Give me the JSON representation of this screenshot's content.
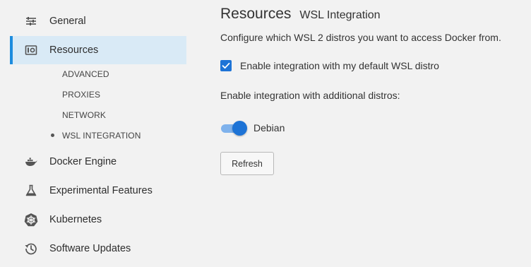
{
  "sidebar": {
    "items": [
      {
        "label": "General",
        "icon": "sliders-icon"
      },
      {
        "label": "Resources",
        "icon": "resources-icon",
        "active": true
      },
      {
        "label": "Docker Engine",
        "icon": "whale-icon"
      },
      {
        "label": "Experimental Features",
        "icon": "flask-icon"
      },
      {
        "label": "Kubernetes",
        "icon": "helm-wheel-icon"
      },
      {
        "label": "Software Updates",
        "icon": "history-icon"
      }
    ],
    "sub_items": [
      {
        "label": "ADVANCED"
      },
      {
        "label": "PROXIES"
      },
      {
        "label": "NETWORK"
      },
      {
        "label": "WSL INTEGRATION",
        "selected": true
      }
    ]
  },
  "main": {
    "title": "Resources",
    "subtitle": "WSL Integration",
    "description": "Configure which WSL 2 distros you want to access Docker from.",
    "default_distro_checkbox": {
      "label": "Enable integration with my default WSL distro",
      "checked": true
    },
    "additional_label": "Enable integration with additional distros:",
    "distros": [
      {
        "name": "Debian",
        "enabled": true
      }
    ],
    "refresh_button": "Refresh"
  },
  "colors": {
    "accent": "#1d73d6",
    "active_bg": "#d9eaf6",
    "active_bar": "#1d8cde",
    "background": "#f2f2f2"
  }
}
